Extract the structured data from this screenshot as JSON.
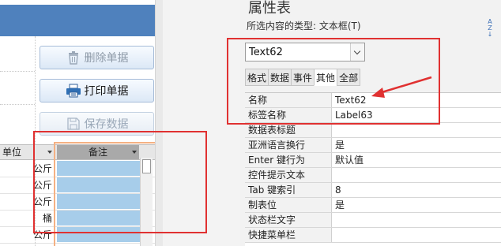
{
  "design": {
    "buttons": [
      {
        "label": "删除单据",
        "icon": "trash-icon",
        "enabled": true
      },
      {
        "label": "打印单据",
        "icon": "printer-icon",
        "enabled": true
      },
      {
        "label": "保存数据",
        "icon": "save-icon",
        "enabled": false
      }
    ],
    "table": {
      "headers": {
        "unit": "单位",
        "note": "备注"
      },
      "units": [
        "公斤",
        "公斤",
        "公斤",
        "桶",
        "公斤"
      ]
    }
  },
  "property_sheet": {
    "title": "属性表",
    "selection_type_label": "所选内容的类型: 文本框(T)",
    "sort_icon": "sort-az-icon",
    "combo_value": "Text62",
    "tabs": [
      "格式",
      "数据",
      "事件",
      "其他",
      "全部"
    ],
    "active_tab": "其他",
    "rows": [
      {
        "name": "名称",
        "value": "Text62"
      },
      {
        "name": "标签名称",
        "value": "Label63"
      },
      {
        "name": "数据表标题",
        "value": ""
      },
      {
        "name": "亚洲语言换行",
        "value": "是"
      },
      {
        "name": "Enter 键行为",
        "value": "默认值"
      },
      {
        "name": "控件提示文本",
        "value": ""
      },
      {
        "name": "Tab 键索引",
        "value": "8"
      },
      {
        "name": "制表位",
        "value": "是"
      },
      {
        "name": "状态栏文字",
        "value": ""
      },
      {
        "name": "快捷菜单栏",
        "value": ""
      }
    ]
  },
  "annotations": {
    "highlight_color": "#e03131",
    "field_selection_color": "#f4b183",
    "note_fill_color": "#a7cdea",
    "header_color": "#4f81bd"
  }
}
